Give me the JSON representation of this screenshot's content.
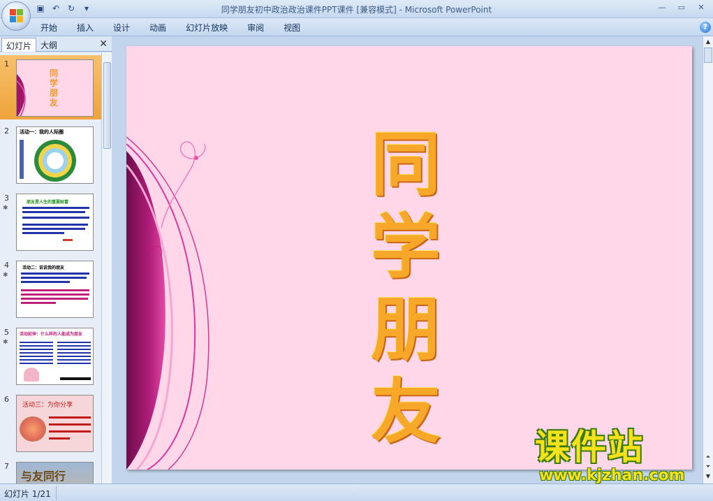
{
  "window": {
    "title": "同学朋友初中政治政治课件PPT课件 [兼容模式] - Microsoft PowerPoint",
    "controls": [
      "—",
      "▭",
      "✕"
    ]
  },
  "quick_access": [
    "save-icon",
    "undo-icon",
    "redo-icon",
    "customize-icon"
  ],
  "ribbon": {
    "tabs": [
      "开始",
      "插入",
      "设计",
      "动画",
      "幻灯片放映",
      "审阅",
      "视图"
    ],
    "help": "?"
  },
  "pane": {
    "tab_slides": "幻灯片",
    "tab_outline": "大纲",
    "close": "✕",
    "thumbnails": [
      {
        "num": "1",
        "anim": "",
        "title": "同学朋友"
      },
      {
        "num": "2",
        "anim": "",
        "title": "活动一：我的人际圈"
      },
      {
        "num": "3",
        "anim": "✱",
        "title": "朋友是人生的重要财富"
      },
      {
        "num": "4",
        "anim": "✱",
        "title": "活动二：说说我的朋友"
      },
      {
        "num": "5",
        "anim": "✱",
        "title": "活动延伸：什么样的人能成为朋友"
      },
      {
        "num": "6",
        "anim": "",
        "title": "活动三：为你分享"
      },
      {
        "num": "7",
        "anim": "",
        "title": "与友同行"
      }
    ]
  },
  "slide": {
    "chars": [
      "同",
      "学",
      "朋",
      "友"
    ]
  },
  "status": {
    "slide_counter": "幻灯片 1/21"
  },
  "watermark": {
    "title": "课件站",
    "url": "www.kjzhan.com"
  }
}
